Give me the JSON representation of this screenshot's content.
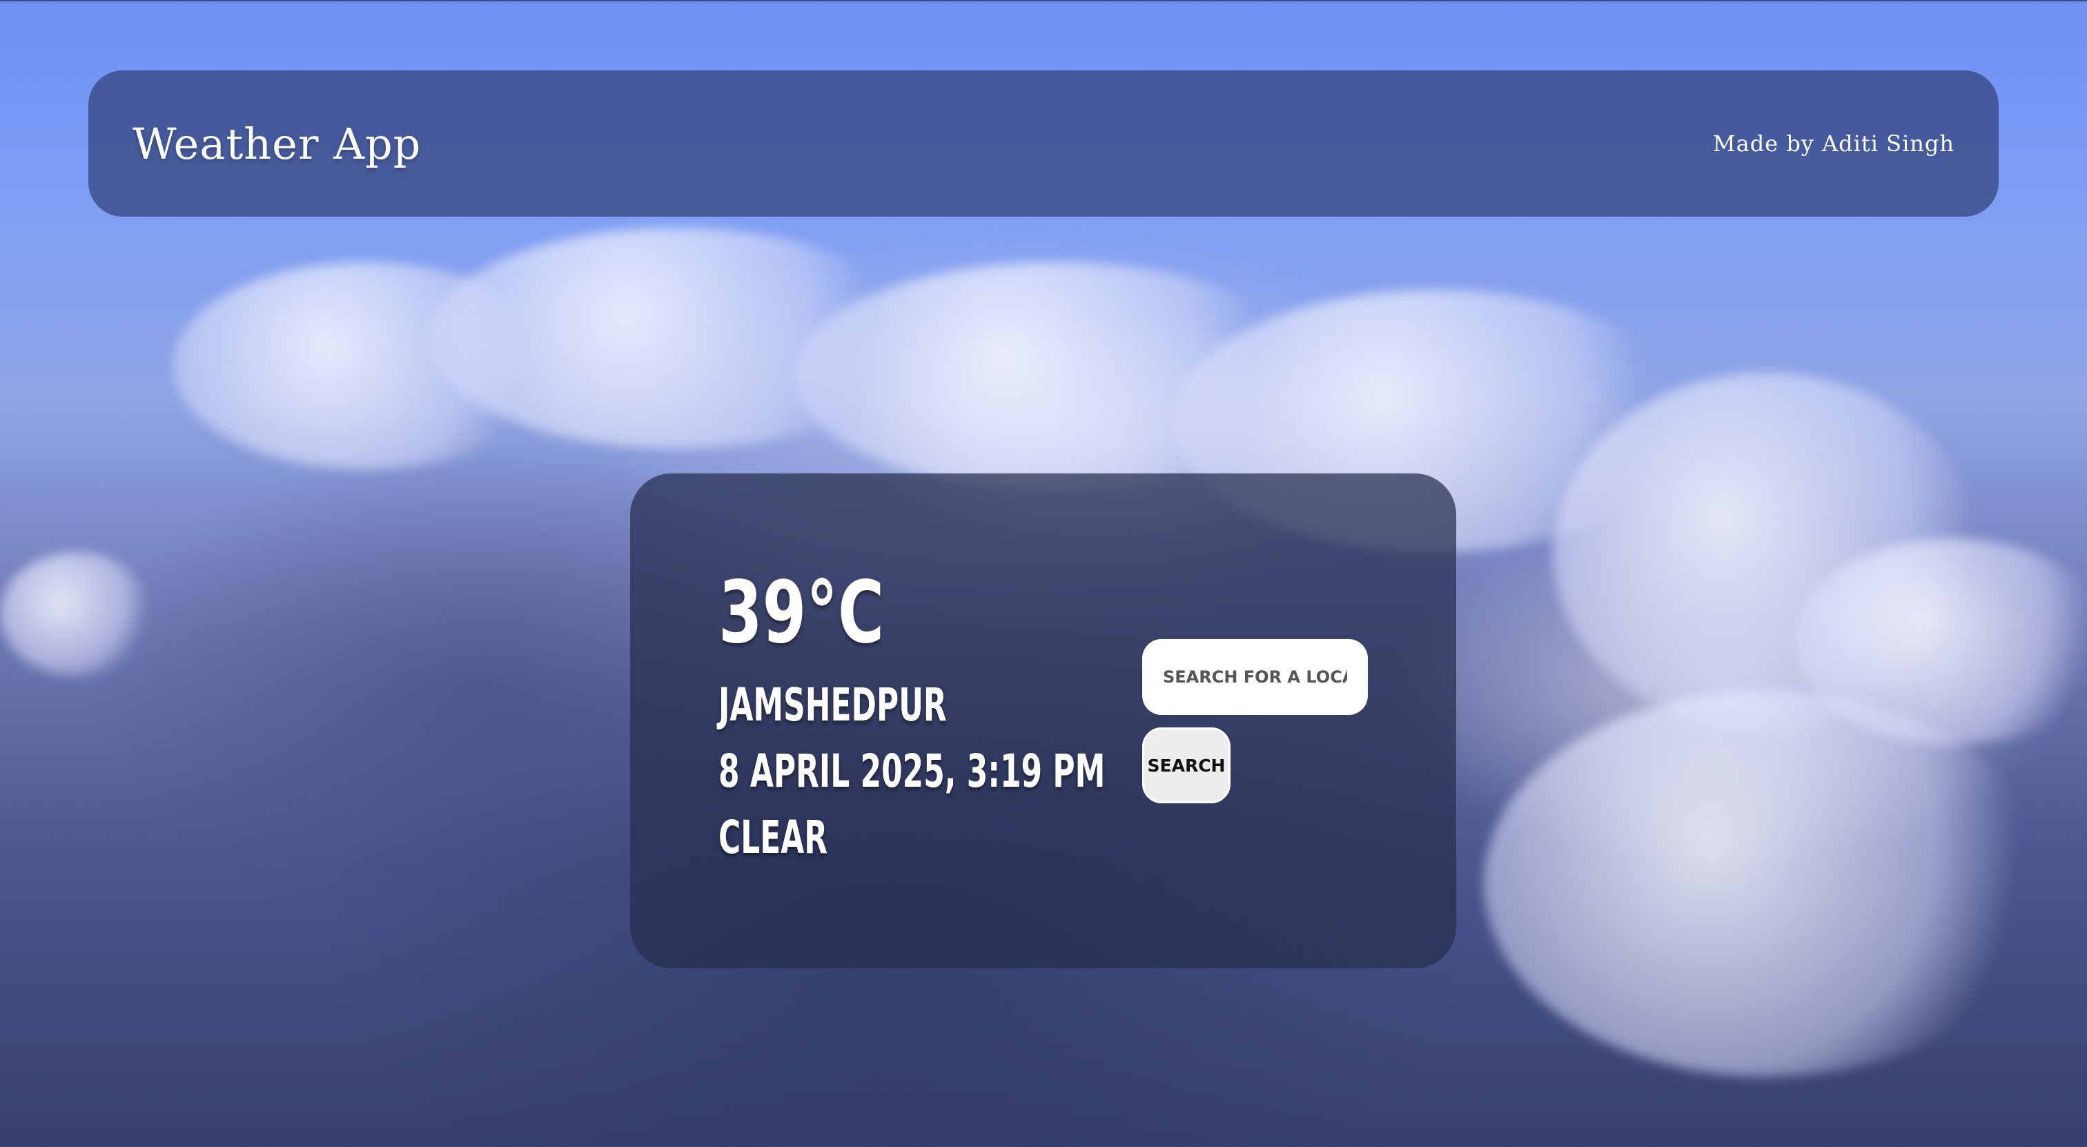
{
  "app": {
    "title": "Weather App",
    "credit": "Made by Aditi Singh"
  },
  "weather": {
    "temperature": "39°C",
    "location": "JAMSHEDPUR",
    "datetime": "8 APRIL 2025, 3:19 PM",
    "condition": "CLEAR"
  },
  "search": {
    "placeholder": "SEARCH FOR A LOCATION",
    "value": "",
    "button_label": "SEARCH"
  },
  "colors": {
    "sky_top": "#6f8ff5",
    "sky_bottom": "#37406c",
    "panel": "#2a3a6e",
    "card": "#262e4e",
    "text": "#ffffff",
    "button_bg": "#ececec"
  },
  "background": {
    "description_icon": "cloudy-sky-background"
  }
}
